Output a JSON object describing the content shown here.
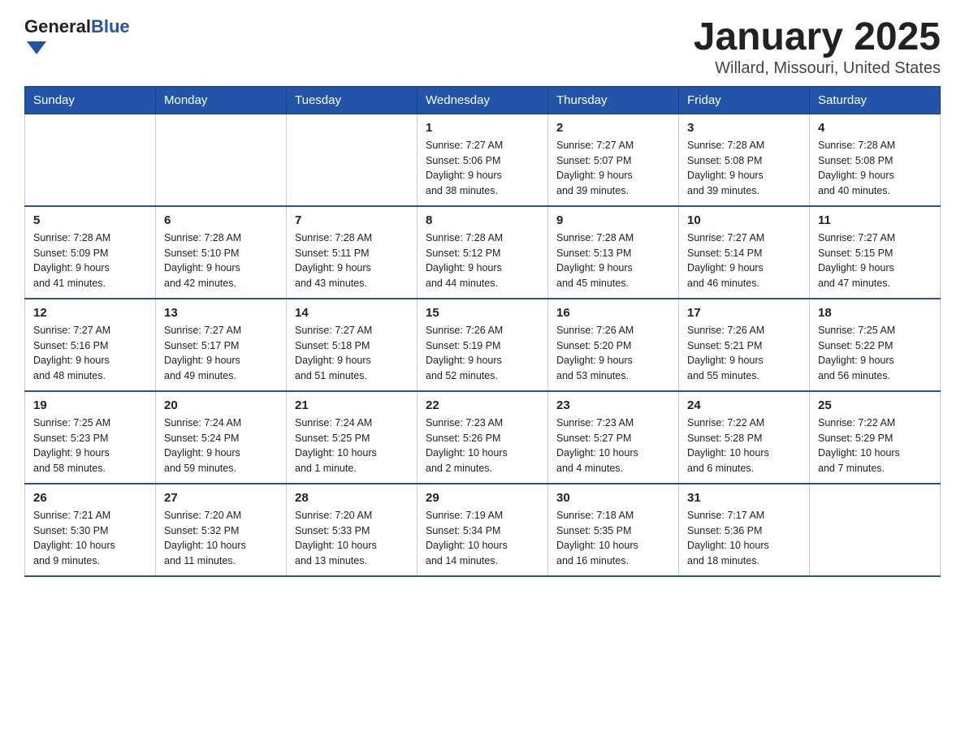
{
  "logo": {
    "text_general": "General",
    "text_blue": "Blue"
  },
  "header": {
    "title": "January 2025",
    "subtitle": "Willard, Missouri, United States"
  },
  "days_of_week": [
    "Sunday",
    "Monday",
    "Tuesday",
    "Wednesday",
    "Thursday",
    "Friday",
    "Saturday"
  ],
  "weeks": [
    [
      {
        "day": "",
        "info": ""
      },
      {
        "day": "",
        "info": ""
      },
      {
        "day": "",
        "info": ""
      },
      {
        "day": "1",
        "info": "Sunrise: 7:27 AM\nSunset: 5:06 PM\nDaylight: 9 hours\nand 38 minutes."
      },
      {
        "day": "2",
        "info": "Sunrise: 7:27 AM\nSunset: 5:07 PM\nDaylight: 9 hours\nand 39 minutes."
      },
      {
        "day": "3",
        "info": "Sunrise: 7:28 AM\nSunset: 5:08 PM\nDaylight: 9 hours\nand 39 minutes."
      },
      {
        "day": "4",
        "info": "Sunrise: 7:28 AM\nSunset: 5:08 PM\nDaylight: 9 hours\nand 40 minutes."
      }
    ],
    [
      {
        "day": "5",
        "info": "Sunrise: 7:28 AM\nSunset: 5:09 PM\nDaylight: 9 hours\nand 41 minutes."
      },
      {
        "day": "6",
        "info": "Sunrise: 7:28 AM\nSunset: 5:10 PM\nDaylight: 9 hours\nand 42 minutes."
      },
      {
        "day": "7",
        "info": "Sunrise: 7:28 AM\nSunset: 5:11 PM\nDaylight: 9 hours\nand 43 minutes."
      },
      {
        "day": "8",
        "info": "Sunrise: 7:28 AM\nSunset: 5:12 PM\nDaylight: 9 hours\nand 44 minutes."
      },
      {
        "day": "9",
        "info": "Sunrise: 7:28 AM\nSunset: 5:13 PM\nDaylight: 9 hours\nand 45 minutes."
      },
      {
        "day": "10",
        "info": "Sunrise: 7:27 AM\nSunset: 5:14 PM\nDaylight: 9 hours\nand 46 minutes."
      },
      {
        "day": "11",
        "info": "Sunrise: 7:27 AM\nSunset: 5:15 PM\nDaylight: 9 hours\nand 47 minutes."
      }
    ],
    [
      {
        "day": "12",
        "info": "Sunrise: 7:27 AM\nSunset: 5:16 PM\nDaylight: 9 hours\nand 48 minutes."
      },
      {
        "day": "13",
        "info": "Sunrise: 7:27 AM\nSunset: 5:17 PM\nDaylight: 9 hours\nand 49 minutes."
      },
      {
        "day": "14",
        "info": "Sunrise: 7:27 AM\nSunset: 5:18 PM\nDaylight: 9 hours\nand 51 minutes."
      },
      {
        "day": "15",
        "info": "Sunrise: 7:26 AM\nSunset: 5:19 PM\nDaylight: 9 hours\nand 52 minutes."
      },
      {
        "day": "16",
        "info": "Sunrise: 7:26 AM\nSunset: 5:20 PM\nDaylight: 9 hours\nand 53 minutes."
      },
      {
        "day": "17",
        "info": "Sunrise: 7:26 AM\nSunset: 5:21 PM\nDaylight: 9 hours\nand 55 minutes."
      },
      {
        "day": "18",
        "info": "Sunrise: 7:25 AM\nSunset: 5:22 PM\nDaylight: 9 hours\nand 56 minutes."
      }
    ],
    [
      {
        "day": "19",
        "info": "Sunrise: 7:25 AM\nSunset: 5:23 PM\nDaylight: 9 hours\nand 58 minutes."
      },
      {
        "day": "20",
        "info": "Sunrise: 7:24 AM\nSunset: 5:24 PM\nDaylight: 9 hours\nand 59 minutes."
      },
      {
        "day": "21",
        "info": "Sunrise: 7:24 AM\nSunset: 5:25 PM\nDaylight: 10 hours\nand 1 minute."
      },
      {
        "day": "22",
        "info": "Sunrise: 7:23 AM\nSunset: 5:26 PM\nDaylight: 10 hours\nand 2 minutes."
      },
      {
        "day": "23",
        "info": "Sunrise: 7:23 AM\nSunset: 5:27 PM\nDaylight: 10 hours\nand 4 minutes."
      },
      {
        "day": "24",
        "info": "Sunrise: 7:22 AM\nSunset: 5:28 PM\nDaylight: 10 hours\nand 6 minutes."
      },
      {
        "day": "25",
        "info": "Sunrise: 7:22 AM\nSunset: 5:29 PM\nDaylight: 10 hours\nand 7 minutes."
      }
    ],
    [
      {
        "day": "26",
        "info": "Sunrise: 7:21 AM\nSunset: 5:30 PM\nDaylight: 10 hours\nand 9 minutes."
      },
      {
        "day": "27",
        "info": "Sunrise: 7:20 AM\nSunset: 5:32 PM\nDaylight: 10 hours\nand 11 minutes."
      },
      {
        "day": "28",
        "info": "Sunrise: 7:20 AM\nSunset: 5:33 PM\nDaylight: 10 hours\nand 13 minutes."
      },
      {
        "day": "29",
        "info": "Sunrise: 7:19 AM\nSunset: 5:34 PM\nDaylight: 10 hours\nand 14 minutes."
      },
      {
        "day": "30",
        "info": "Sunrise: 7:18 AM\nSunset: 5:35 PM\nDaylight: 10 hours\nand 16 minutes."
      },
      {
        "day": "31",
        "info": "Sunrise: 7:17 AM\nSunset: 5:36 PM\nDaylight: 10 hours\nand 18 minutes."
      },
      {
        "day": "",
        "info": ""
      }
    ]
  ]
}
